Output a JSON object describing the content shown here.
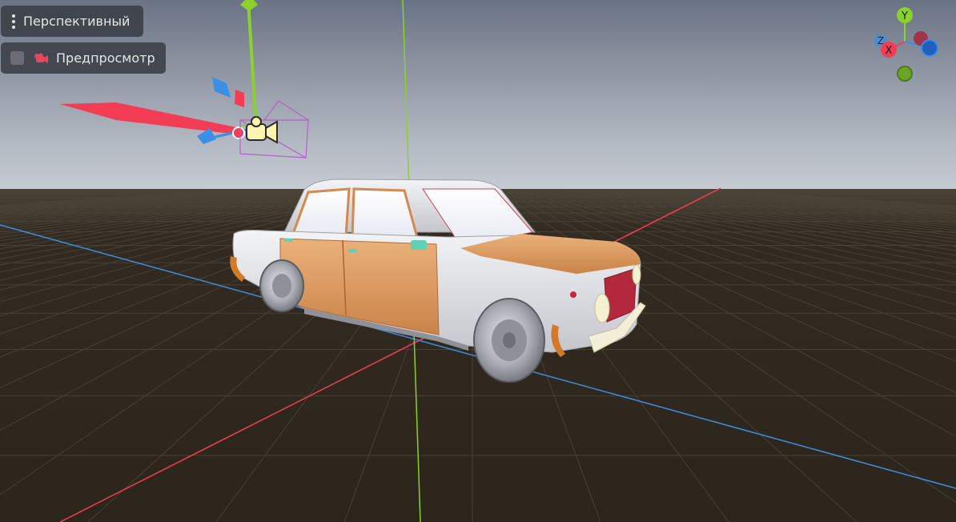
{
  "toolbar": {
    "view_mode_label": "Перспективный",
    "preview_label": "Предпросмотр",
    "preview_checked": false
  },
  "gizmo": {
    "axis_labels": {
      "x": "X",
      "y": "Y",
      "z": "Z"
    },
    "colors": {
      "x": "#f23d55",
      "y": "#8ad12b",
      "z": "#3b8fe6"
    }
  },
  "scene": {
    "sky_top": "#6a7384",
    "sky_horizon": "#c7ccd3",
    "ground_color": "#2e271e",
    "grid_color": "#4b4539",
    "car_body_color": "#e5e6ea",
    "car_primer_color": "#e2a266",
    "grille_color": "#b3283b",
    "camera_frustum_color": "#b460c8"
  }
}
